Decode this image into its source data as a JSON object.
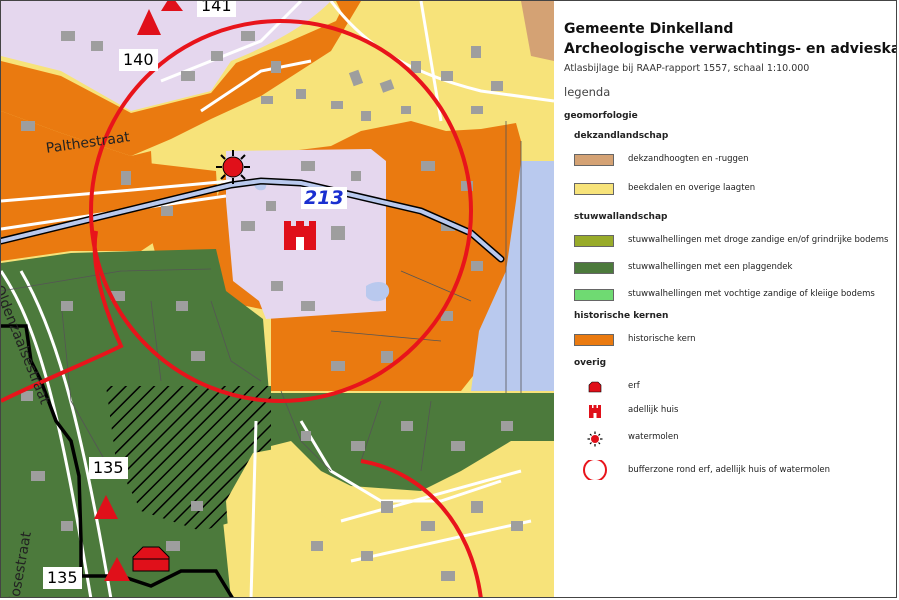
{
  "title_line1": "Gemeente Dinkelland",
  "title_line2": "Archeologische verwachtings- en advieskaart",
  "subtitle": "Atlasbijlage bij RAAP-rapport 1557, schaal 1:10.000",
  "legend_heading": "legenda",
  "geomorfologie": "geomorfologie",
  "groups": [
    {
      "name": "dekzandlandschap",
      "items": [
        {
          "label": "dekzandhoogten en -ruggen",
          "color": "#d4a274"
        },
        {
          "label": "beekdalen en overige laagten",
          "color": "#f7e37a"
        }
      ]
    },
    {
      "name": "stuwwallandschap",
      "items": [
        {
          "label": "stuwwalhellingen met droge zandige en/of grindrijke bodems",
          "color": "#98ab2a"
        },
        {
          "label": "stuwwalhellingen met een plaggendek",
          "color": "#4c7a3c"
        },
        {
          "label": "stuwwalhellingen met vochtige zandige of kleiige bodems",
          "color": "#6fda72"
        }
      ]
    },
    {
      "name": "historische kernen",
      "items": [
        {
          "label": "historische kern",
          "color": "#ea7a10"
        }
      ]
    }
  ],
  "overig": {
    "name": "overig",
    "items": [
      {
        "label": "erf",
        "icon": "erf-icon"
      },
      {
        "label": "adellijk huis",
        "icon": "adellijk-huis-icon"
      },
      {
        "label": "watermolen",
        "icon": "watermolen-icon"
      },
      {
        "label": "bufferzone rond erf, adellijk huis of watermolen",
        "icon": "bufferzone-icon"
      }
    ]
  },
  "map": {
    "site_number": "213",
    "street_labels": [
      "Palthestraat",
      "Oldenzaalsestraat",
      "losestraat"
    ],
    "point_labels": [
      "141",
      "140",
      "135",
      "135"
    ]
  },
  "colors": {
    "symbol_red": "#e0101a",
    "buffer_red": "#e8141b",
    "water_blue": "#b9c9ee",
    "built_lilac": "#e5d7ee"
  }
}
